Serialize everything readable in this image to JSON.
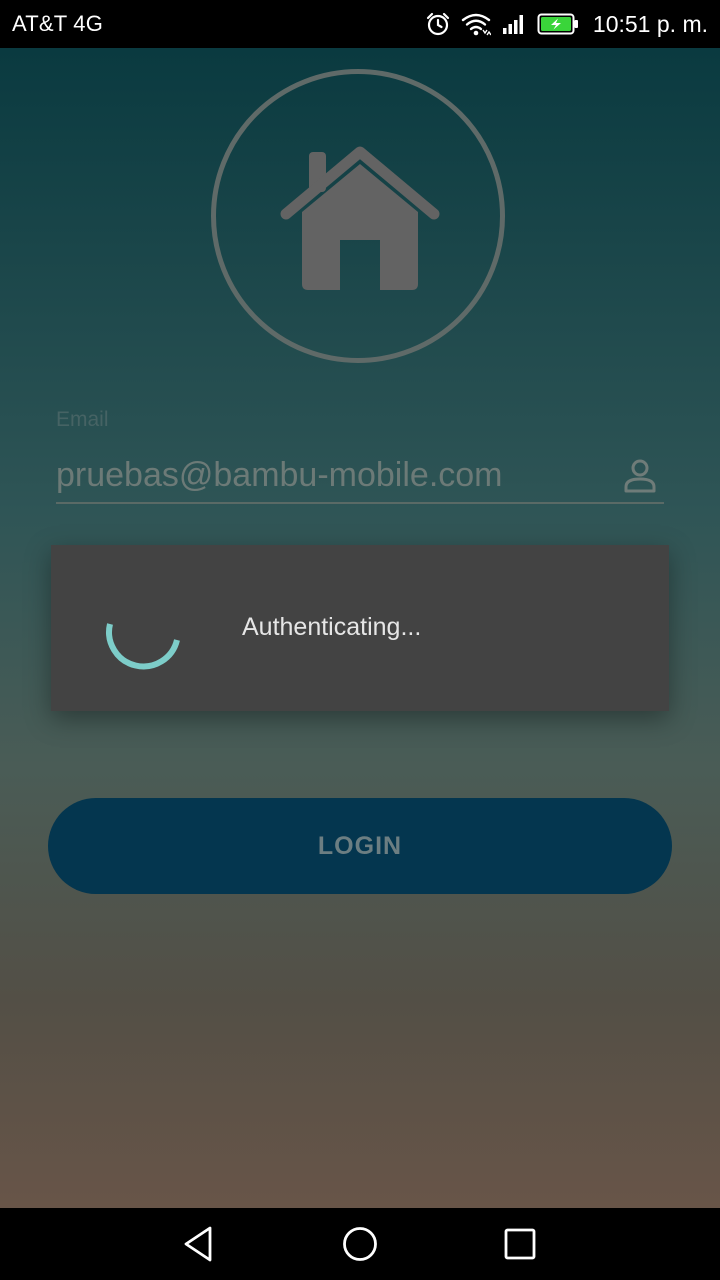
{
  "status_bar": {
    "carrier": "AT&T 4G",
    "time": "10:51 p. m.",
    "icons": [
      "alarm-icon",
      "wifi-icon",
      "signal-icon",
      "battery-charging-icon"
    ],
    "battery_color": "#3ad53a"
  },
  "logo": {
    "icon": "home-icon"
  },
  "email": {
    "label": "Email",
    "value": "pruebas@bambu-mobile.com",
    "icon": "person-icon"
  },
  "dialog": {
    "message": "Authenticating...",
    "spinner_color": "#7dcdc9"
  },
  "login": {
    "label": "LOGIN",
    "color": "#04364f"
  },
  "nav_bar": {
    "buttons": [
      "back-icon",
      "home-circle-icon",
      "recents-icon"
    ]
  }
}
